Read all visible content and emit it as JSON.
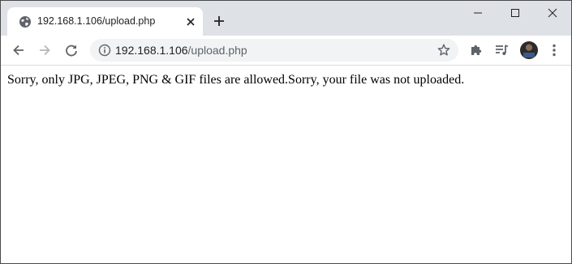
{
  "tab": {
    "title": "192.168.1.106/upload.php",
    "favicon_icon": "globe-icon",
    "close_icon": "close-icon"
  },
  "tabstrip": {
    "new_tab_icon": "plus-icon"
  },
  "window_controls": {
    "minimize_icon": "minimize-icon",
    "maximize_icon": "maximize-icon",
    "close_icon": "close-icon"
  },
  "toolbar": {
    "back_icon": "arrow-left-icon",
    "forward_icon": "arrow-right-icon",
    "reload_icon": "reload-icon",
    "extensions_icon": "puzzle-icon",
    "media_icon": "media-queue-icon",
    "menu_icon": "kebab-menu-icon"
  },
  "omnibox": {
    "host": "192.168.1.106",
    "path": "/upload.php",
    "info_icon": "info-icon",
    "bookmark_icon": "star-icon"
  },
  "page": {
    "message": "Sorry, only JPG, JPEG, PNG & GIF files are allowed.Sorry, your file was not uploaded."
  },
  "colors": {
    "tabstrip_bg": "#dee1e6",
    "omnibox_bg": "#f1f3f4",
    "icon": "#5f6368",
    "text": "#202124"
  }
}
